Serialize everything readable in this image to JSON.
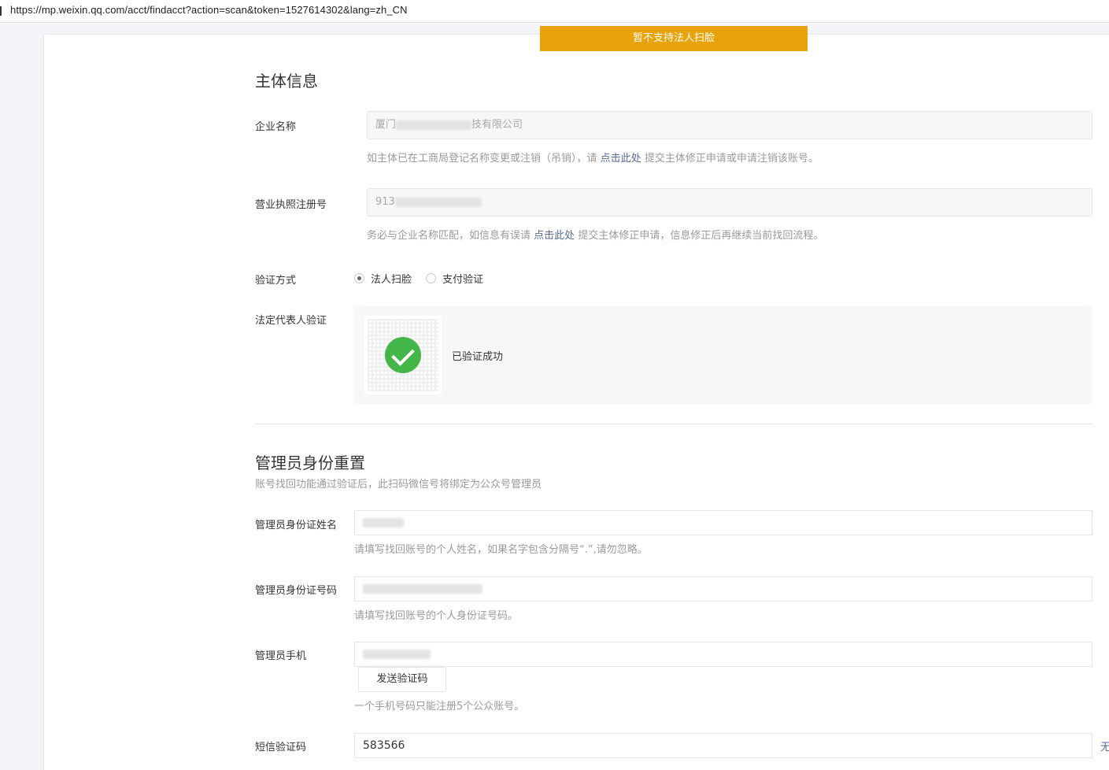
{
  "browser": {
    "url": "https://mp.weixin.qq.com/acct/findacct?action=scan&token=1527614302&lang=zh_CN"
  },
  "banner": {
    "text": "暂不支持法人扫脸"
  },
  "entity": {
    "title": "主体信息",
    "company": {
      "label": "企业名称",
      "value_prefix": "厦门",
      "value_suffix": "技有限公司",
      "tip_before": "如主体已在工商局登记名称变更或注销（吊销），请",
      "tip_link": "点击此处",
      "tip_after": "提交主体修正申请或申请注销该账号。"
    },
    "license": {
      "label": "营业执照注册号",
      "value_prefix": "913",
      "tip_before": "务必与企业名称匹配，如信息有误请",
      "tip_link": "点击此处",
      "tip_after": "提交主体修正申请，信息修正后再继续当前找回流程。"
    },
    "verify_method": {
      "label": "验证方式",
      "options": [
        "法人扫脸",
        "支付验证"
      ],
      "selected_index": 0
    },
    "legal_rep": {
      "label": "法定代表人验证",
      "status": "已验证成功"
    }
  },
  "admin": {
    "title": "管理员身份重置",
    "subtitle": "账号找回功能通过验证后，此扫码微信号将绑定为公众号管理员",
    "name": {
      "label": "管理员身份证姓名",
      "tip": "请填写找回账号的个人姓名，如果名字包含分隔号“.”,请勿忽略。"
    },
    "id_number": {
      "label": "管理员身份证号码",
      "tip": "请填写找回账号的个人身份证号码。"
    },
    "phone": {
      "label": "管理员手机",
      "send_code_button": "发送验证码",
      "tip": "一个手机号码只能注册5个公众账号。"
    },
    "sms": {
      "label": "短信验证码",
      "value": "583566",
      "side_text": "无"
    }
  }
}
